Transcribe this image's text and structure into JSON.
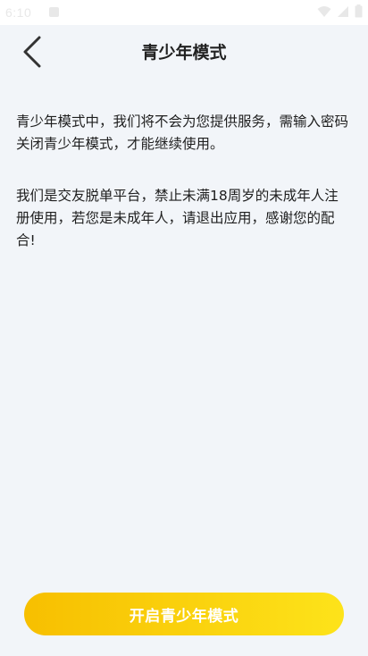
{
  "status_bar": {
    "time": "6:10"
  },
  "nav": {
    "title": "青少年模式"
  },
  "content": {
    "paragraph_1": "青少年模式中，我们将不会为您提供服务，需输入密码关闭青少年模式，才能继续使用。",
    "paragraph_2": "我们是交友脱单平台，禁止未满18周岁的未成年人注册使用，若您是未成年人，请退出应用，感谢您的配合!"
  },
  "action": {
    "button_label": "开启青少年模式"
  },
  "colors": {
    "background": "#f2f5f9",
    "button_gradient_start": "#f7bf00",
    "button_gradient_end": "#fde31a",
    "text": "#1e1e1e"
  }
}
